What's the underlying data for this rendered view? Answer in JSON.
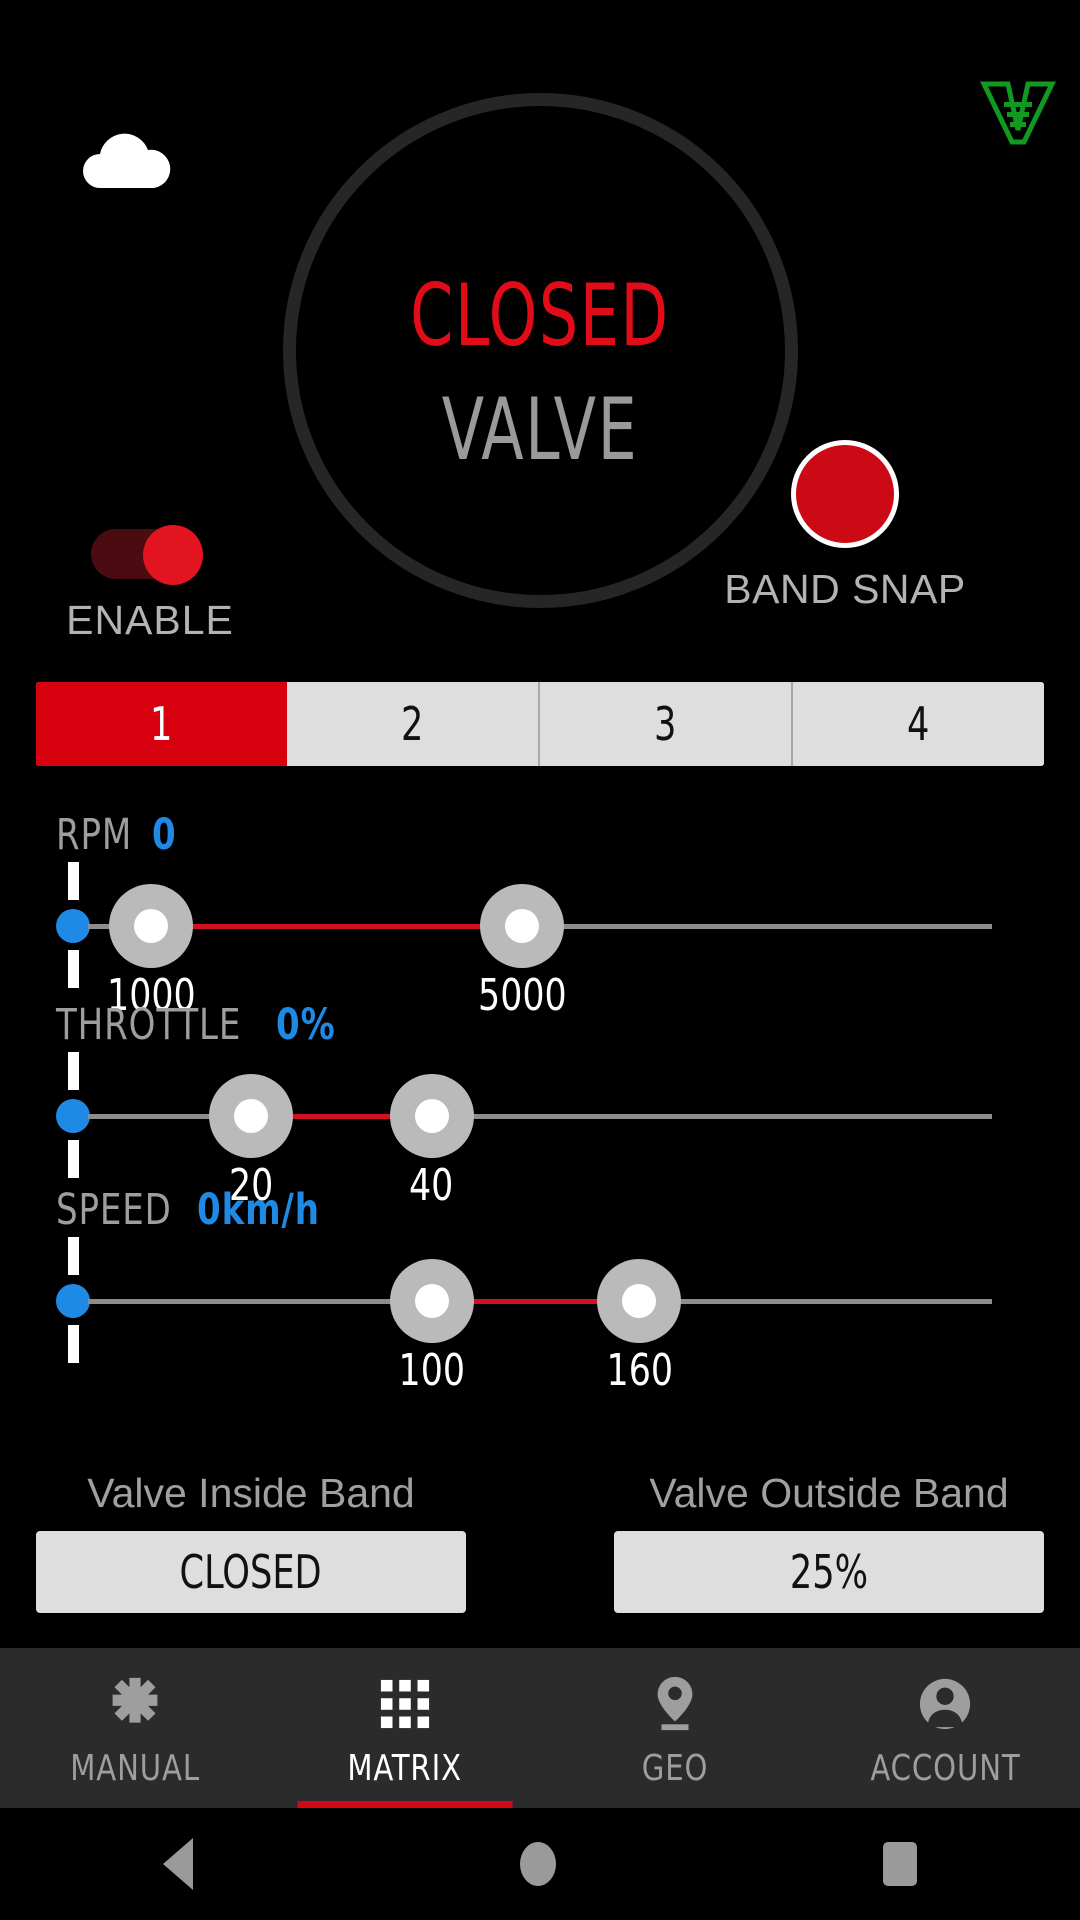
{
  "header": {
    "cloud_icon": "cloud-icon",
    "brand_logo": "valve-v-logo",
    "brand_color": "#119922"
  },
  "dial": {
    "state": "CLOSED",
    "word": "VALVE",
    "state_color": "#e00c18",
    "word_color": "#9a9a9a"
  },
  "enable": {
    "label": "ENABLE",
    "state": "on",
    "thumb_color": "#e2141f",
    "track_color": "#4a0c10"
  },
  "band_snap": {
    "label": "BAND SNAP",
    "color": "#cc0a16"
  },
  "tabs": {
    "items": [
      {
        "label": "1",
        "active": true
      },
      {
        "label": "2",
        "active": false
      },
      {
        "label": "3",
        "active": false
      },
      {
        "label": "4",
        "active": false
      }
    ],
    "active_color": "#d6000f",
    "inactive_color": "#dedede"
  },
  "sliders": [
    {
      "name": "RPM",
      "current_label": "0",
      "low_label": "1000",
      "high_label": "5000",
      "low_pct": 7,
      "high_pct": 48,
      "current_pct": 0
    },
    {
      "name": "THROTTLE",
      "current_label": "0%",
      "low_label": "20",
      "high_label": "40",
      "low_pct": 18,
      "high_pct": 38,
      "current_pct": 0
    },
    {
      "name": "SPEED",
      "current_label": "0km/h",
      "low_label": "100",
      "high_label": "160",
      "low_pct": 38,
      "high_pct": 61,
      "current_pct": 0
    }
  ],
  "slider_accent": "#1e8ae5",
  "slider_range_color": "#d31020",
  "bands": {
    "inside": {
      "title": "Valve Inside Band",
      "value": "CLOSED"
    },
    "outside": {
      "title": "Valve Outside Band",
      "value": "25%"
    }
  },
  "bottom_nav": {
    "items": [
      {
        "label": "MANUAL",
        "icon": "dpad-icon",
        "active": false
      },
      {
        "label": "MATRIX",
        "icon": "grid-icon",
        "active": true
      },
      {
        "label": "GEO",
        "icon": "map-pin-icon",
        "active": false
      },
      {
        "label": "ACCOUNT",
        "icon": "person-icon",
        "active": false
      }
    ],
    "active_underline_color": "#cf0a16"
  },
  "system_bar": {
    "back": "back-triangle-icon",
    "home": "home-circle-icon",
    "recents": "recents-square-icon"
  }
}
